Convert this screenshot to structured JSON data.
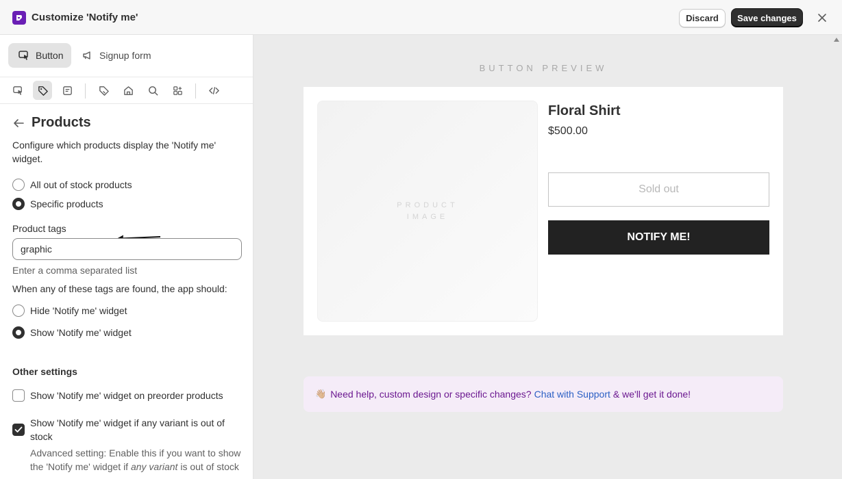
{
  "header": {
    "title": "Customize 'Notify me'",
    "discard_label": "Discard",
    "save_label": "Save changes"
  },
  "sidebar": {
    "tabs": [
      {
        "label": "Button",
        "icon": "cursor-click-icon",
        "active": true
      },
      {
        "label": "Signup form",
        "icon": "megaphone-icon",
        "active": false
      }
    ],
    "toolbar_icons": [
      "cursor-icon",
      "tag-icon",
      "note-icon",
      "price-tag-icon",
      "home-icon",
      "search-icon",
      "apps-icon",
      "code-icon"
    ],
    "section": {
      "title": "Products",
      "description": "Configure which products display the 'Notify me' widget.",
      "scope_options": [
        {
          "label": "All out of stock products",
          "checked": false
        },
        {
          "label": "Specific products",
          "checked": true
        }
      ],
      "tags_label": "Product tags",
      "tags_value": "graphic",
      "tags_help": "Enter a comma separated list",
      "action_label": "When any of these tags are found, the app should:",
      "action_options": [
        {
          "label": "Hide 'Notify me' widget",
          "checked": false
        },
        {
          "label": "Show 'Notify me' widget",
          "checked": true
        }
      ]
    },
    "other": {
      "heading": "Other settings",
      "preorder_label": "Show 'Notify me' widget on preorder products",
      "preorder_checked": false,
      "variant_label": "Show 'Notify me' widget if any variant is out of stock",
      "variant_checked": true,
      "advanced_prefix": "Advanced setting: Enable this if you want to show the 'Notify me' widget if",
      "advanced_emph": "any variant",
      "advanced_suffix": "is out of stock"
    }
  },
  "preview": {
    "heading": "BUTTON PREVIEW",
    "image_placeholder": "PRODUCT IMAGE",
    "product_name": "Floral Shirt",
    "product_price": "$500.00",
    "soldout_label": "Sold out",
    "notify_label": "NOTIFY ME!",
    "help": {
      "emoji": "👋🏼",
      "text_before": "Need help, custom design or specific changes?",
      "link": "Chat with Support",
      "text_after": "& we'll get it done!"
    }
  },
  "colors": {
    "brand": "#6a1fb5",
    "primary_button": "#303030",
    "notify_button": "#222222",
    "link": "#2b5fc4",
    "banner_bg": "#f5ecf8"
  }
}
